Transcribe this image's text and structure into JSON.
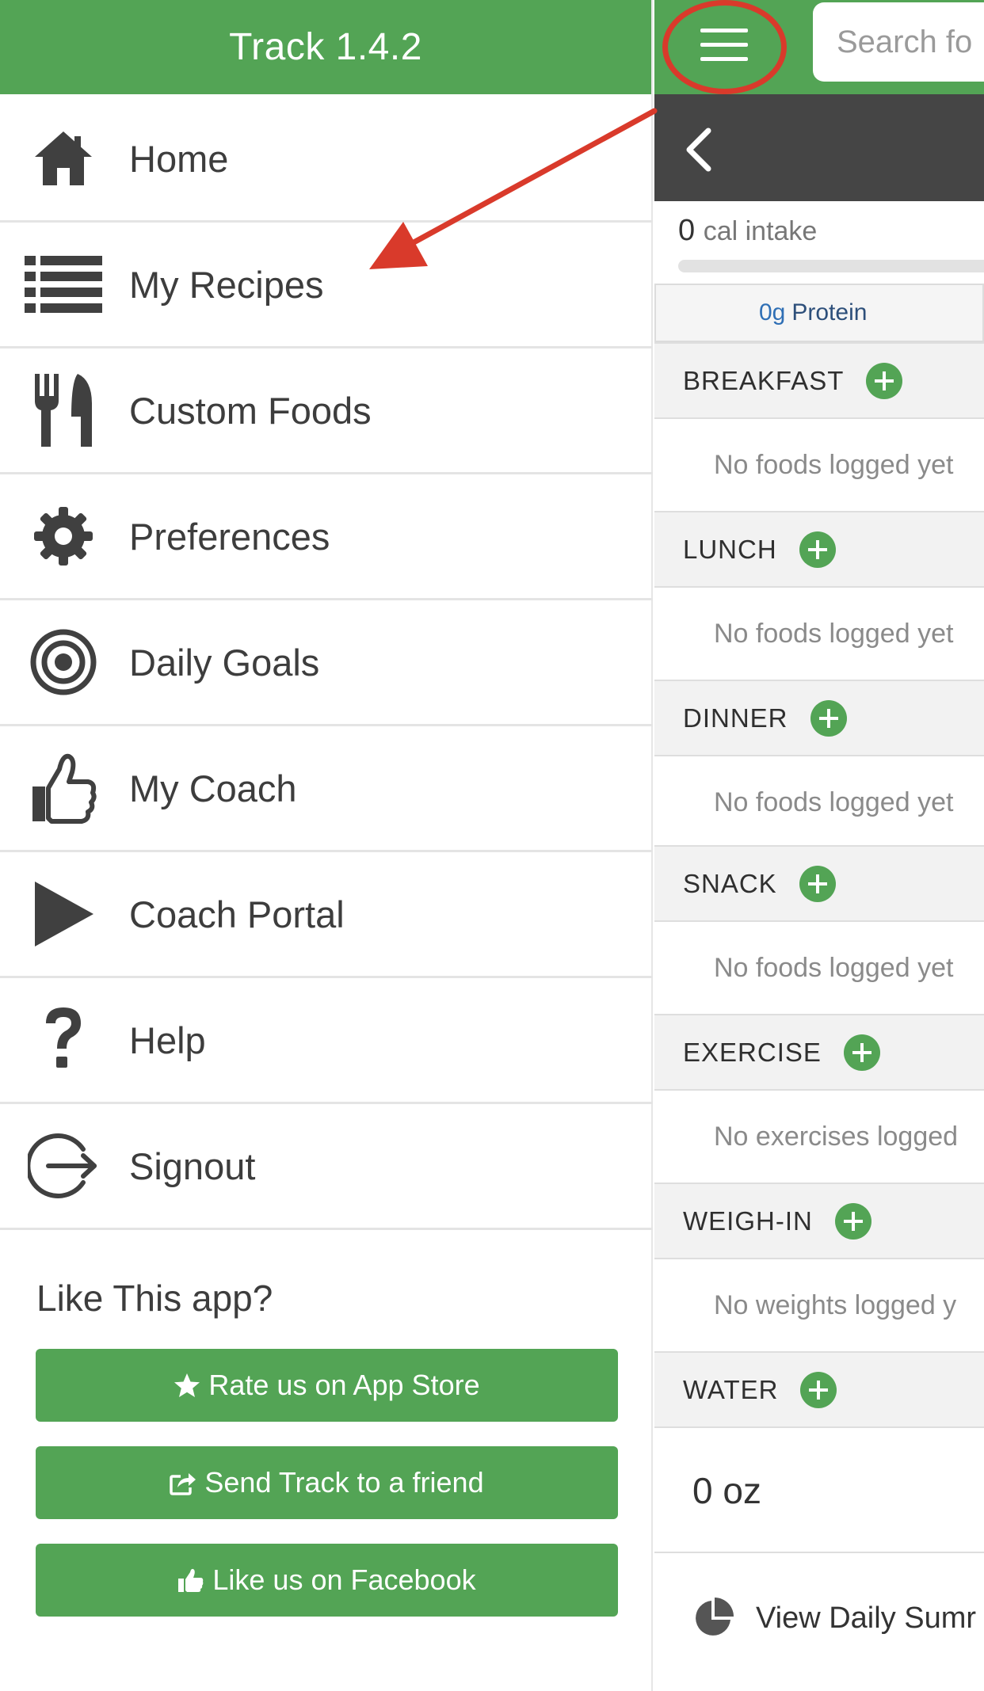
{
  "drawer": {
    "title": "Track 1.4.2",
    "items": [
      {
        "label": "Home",
        "icon": "home-icon"
      },
      {
        "label": "My Recipes",
        "icon": "list-icon"
      },
      {
        "label": "Custom Foods",
        "icon": "fork-knife-icon"
      },
      {
        "label": "Preferences",
        "icon": "gear-icon"
      },
      {
        "label": "Daily Goals",
        "icon": "target-icon"
      },
      {
        "label": "My Coach",
        "icon": "thumbs-up-icon"
      },
      {
        "label": "Coach Portal",
        "icon": "play-icon"
      },
      {
        "label": "Help",
        "icon": "question-icon"
      },
      {
        "label": "Signout",
        "icon": "signout-icon"
      }
    ],
    "like_title": "Like This app?",
    "buttons": {
      "rate": "Rate us on App Store",
      "send": "Send Track to a friend",
      "facebook": "Like us on Facebook"
    }
  },
  "main": {
    "search_placeholder": "Search fo",
    "calories": {
      "value": "0",
      "label": "cal intake"
    },
    "protein": {
      "value": "0g",
      "label": "Protein"
    },
    "sections": [
      {
        "label": "BREAKFAST",
        "empty": "No foods logged yet"
      },
      {
        "label": "LUNCH",
        "empty": "No foods logged yet"
      },
      {
        "label": "DINNER",
        "empty": "No foods logged yet"
      },
      {
        "label": "SNACK",
        "empty": "No foods logged yet"
      },
      {
        "label": "EXERCISE",
        "empty": "No exercises logged"
      },
      {
        "label": "WEIGH-IN",
        "empty": "No weights logged y"
      },
      {
        "label": "WATER",
        "empty": ""
      }
    ],
    "water_amount": "0 oz",
    "summary_label": "View Daily Sumr"
  },
  "colors": {
    "accent": "#53a455",
    "dark_bar": "#454545",
    "annotation": "#d93a2b"
  }
}
